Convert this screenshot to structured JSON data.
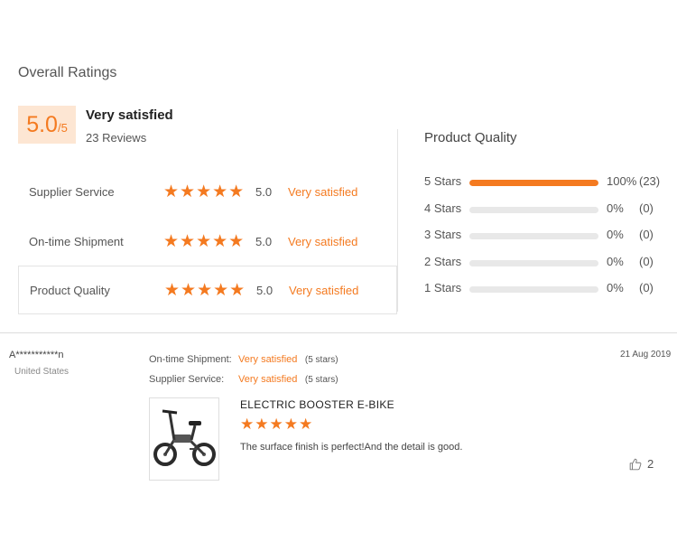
{
  "overall": {
    "title": "Overall Ratings",
    "score": "5.0",
    "score_denominator": "/5",
    "summary": "Very satisfied",
    "reviews": "23 Reviews"
  },
  "ratings": [
    {
      "label": "Supplier Service",
      "stars": "★★★★★",
      "score": "5.0",
      "status": "Very satisfied"
    },
    {
      "label": "On-time Shipment",
      "stars": "★★★★★",
      "score": "5.0",
      "status": "Very satisfied"
    },
    {
      "label": "Product Quality",
      "stars": "★★★★★",
      "score": "5.0",
      "status": "Very satisfied"
    }
  ],
  "product_quality": {
    "title": "Product Quality",
    "distribution": [
      {
        "label": "5 Stars",
        "percent": "100%",
        "count": "(23)",
        "fraction": 1.0
      },
      {
        "label": "4 Stars",
        "percent": "0%",
        "count": "(0)",
        "fraction": 0
      },
      {
        "label": "3 Stars",
        "percent": "0%",
        "count": "(0)",
        "fraction": 0
      },
      {
        "label": "2 Stars",
        "percent": "0%",
        "count": "(0)",
        "fraction": 0
      },
      {
        "label": "1 Stars",
        "percent": "0%",
        "count": "(0)",
        "fraction": 0
      }
    ]
  },
  "review": {
    "reviewer": "A***********n",
    "country": "United States",
    "date": "21 Aug 2019",
    "fields": [
      {
        "label": "On-time Shipment:",
        "value": "Very satisfied",
        "stars": "(5 stars)"
      },
      {
        "label": "Supplier Service:",
        "value": "Very satisfied",
        "stars": "(5 stars)"
      }
    ],
    "product_name": "ELECTRIC BOOSTER E-BIKE",
    "stars": "★★★★★",
    "text": "The surface finish is perfect!And the detail is good.",
    "likes": "2"
  },
  "colors": {
    "accent": "#f47a20",
    "score_bg": "#fde6d3",
    "track": "#e8e8e8"
  },
  "icons": {
    "like": "thumbs-up-icon",
    "star": "star-icon",
    "product": "e-bike-thumbnail"
  }
}
